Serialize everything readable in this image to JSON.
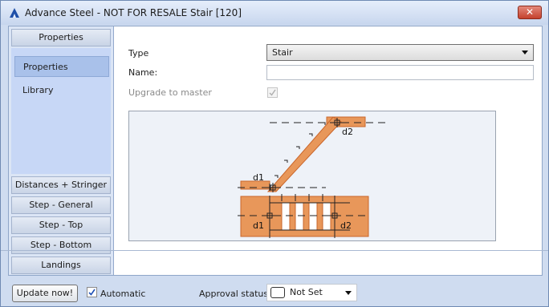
{
  "window": {
    "title": "Advance Steel - NOT FOR RESALE  Stair [120]",
    "close_label": "✕"
  },
  "sidebar": {
    "header": "Properties",
    "items": [
      {
        "label": "Properties",
        "selected": true
      },
      {
        "label": "Library",
        "selected": false
      }
    ],
    "groups": [
      {
        "label": "Distances + Stringer"
      },
      {
        "label": "Step - General"
      },
      {
        "label": "Step - Top"
      },
      {
        "label": "Step - Bottom"
      },
      {
        "label": "Landings"
      }
    ]
  },
  "form": {
    "type_label": "Type",
    "type_value": "Stair",
    "name_label": "Name:",
    "name_value": "",
    "upgrade_label": "Upgrade to master",
    "upgrade_checked": true,
    "upgrade_enabled": false
  },
  "preview": {
    "labels": {
      "d1_top": "d1",
      "d2_top": "d2",
      "d1_bottom": "d1",
      "d2_bottom": "d2"
    },
    "colors": {
      "steel": "#e8975a",
      "steel_stroke": "#c9652a",
      "dash": "#222222"
    }
  },
  "footer": {
    "update_label": "Update now!",
    "automatic_label": "Automatic",
    "automatic_checked": true,
    "approval_label": "Approval status",
    "approval_value": "Not Set"
  },
  "icons": {
    "app": "advance-steel-logo-icon",
    "dropdown": "chevron-down-icon",
    "check": "checkmark-icon"
  }
}
